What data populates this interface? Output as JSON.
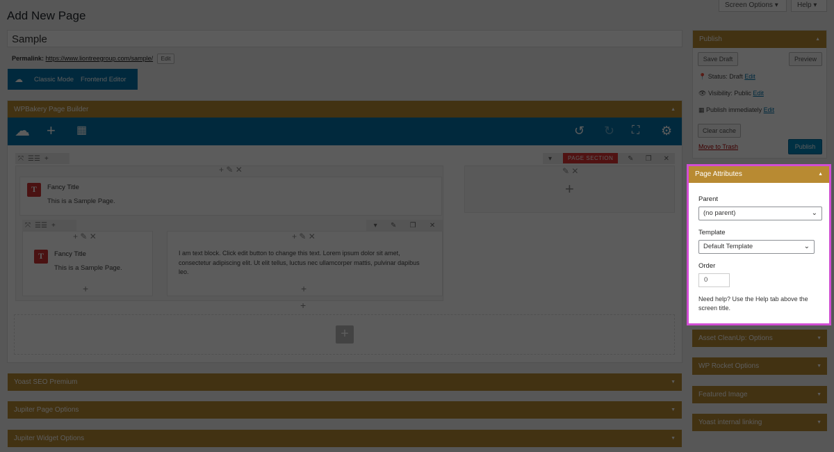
{
  "top_tabs": {
    "screen_options": "Screen Options ▾",
    "help": "Help ▾"
  },
  "page_title": "Add New Page",
  "title_value": "Sample",
  "permalink": {
    "label": "Permalink:",
    "url": "https://www.liontreegroup.com/sample/",
    "edit": "Edit"
  },
  "mode_bar": {
    "classic": "Classic Mode",
    "frontend": "Frontend Editor"
  },
  "wpbakery": {
    "title": "WPBakery Page Builder"
  },
  "builder": {
    "page_section": "PAGE SECTION",
    "fancy_title": "Fancy Title",
    "sample_text": "This is a Sample Page.",
    "fancy_title_2": "Fancy Title",
    "sample_text_2": "This is a Sample Page.",
    "text_block": "I am text block. Click edit button to change this text. Lorem ipsum dolor sit amet, consectetur adipiscing elit. Ut elit tellus, luctus nec ullamcorper mattis, pulvinar dapibus leo."
  },
  "bottom_boxes": [
    "Yoast SEO Premium",
    "Jupiter Page Options",
    "Jupiter Widget Options"
  ],
  "publish": {
    "title": "Publish",
    "save_draft": "Save Draft",
    "preview": "Preview",
    "status_label": "Status:",
    "status_value": "Draft",
    "status_edit": "Edit",
    "visibility_label": "Visibility:",
    "visibility_value": "Public",
    "visibility_edit": "Edit",
    "publish_label": "Publish",
    "publish_value": "immediately",
    "publish_edit": "Edit",
    "clear_cache": "Clear cache",
    "trash": "Move to Trash",
    "publish_btn": "Publish"
  },
  "attributes": {
    "title": "Page Attributes",
    "parent_label": "Parent",
    "parent_value": "(no parent)",
    "template_label": "Template",
    "template_value": "Default Template",
    "order_label": "Order",
    "order_value": "0",
    "help": "Need help? Use the Help tab above the screen title."
  },
  "side_boxes": [
    "Asset CleanUp: Options",
    "WP Rocket Options",
    "Featured Image",
    "Yoast internal linking"
  ],
  "colors": {
    "box_header": "#b88a32",
    "wpb_blue": "#0473aa",
    "highlight": "#d14dd4"
  }
}
